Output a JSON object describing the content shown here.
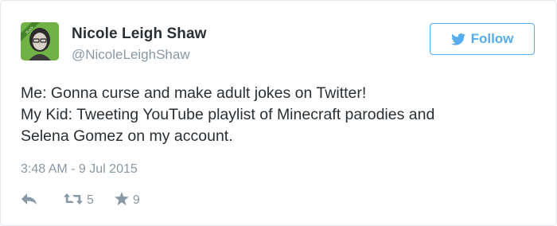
{
  "author": {
    "name": "Nicole Leigh Shaw",
    "handle": "@NicoleLeighShaw"
  },
  "follow_button": {
    "label": "Follow",
    "icon": "twitter-bird-icon"
  },
  "tweet": {
    "lines": [
      "Me: Gonna curse and make adult jokes on Twitter!",
      "My Kid: Tweeting YouTube playlist of Minecraft parodies and",
      "Selena Gomez on my account."
    ],
    "timestamp": "3:48 AM - 9 Jul 2015"
  },
  "actions": {
    "reply_icon": "reply-icon",
    "retweet_icon": "retweet-icon",
    "retweet_count": "5",
    "favorite_icon": "star-icon",
    "favorite_count": "9"
  },
  "colors": {
    "accent": "#55acee",
    "text": "#292f33",
    "muted": "#8899a6",
    "border": "#e1e8ed"
  }
}
